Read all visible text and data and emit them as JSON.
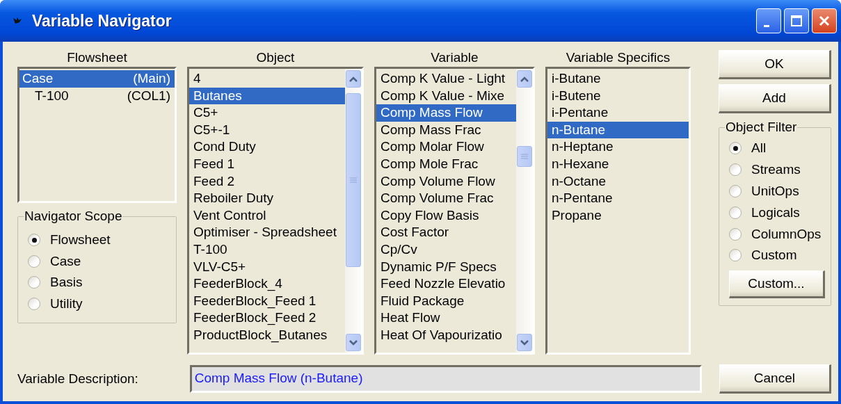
{
  "window": {
    "title": "Variable Navigator"
  },
  "flowsheet": {
    "header": "Flowsheet",
    "items": [
      {
        "name": "Case",
        "tag": "(Main)",
        "selected": true,
        "children": [
          {
            "name": "T-100",
            "tag": "(COL1)",
            "selected": false
          }
        ]
      }
    ]
  },
  "navigator_scope": {
    "title": "Navigator Scope",
    "options": [
      {
        "label": "Flowsheet",
        "selected": true
      },
      {
        "label": "Case",
        "selected": false
      },
      {
        "label": "Basis",
        "selected": false
      },
      {
        "label": "Utility",
        "selected": false
      }
    ]
  },
  "object": {
    "header": "Object",
    "items": [
      {
        "label": "4",
        "selected": false
      },
      {
        "label": "Butanes",
        "selected": true
      },
      {
        "label": "C5+",
        "selected": false
      },
      {
        "label": "C5+-1",
        "selected": false
      },
      {
        "label": "Cond Duty",
        "selected": false
      },
      {
        "label": "Feed 1",
        "selected": false
      },
      {
        "label": "Feed 2",
        "selected": false
      },
      {
        "label": "Reboiler Duty",
        "selected": false
      },
      {
        "label": "Vent Control",
        "selected": false
      },
      {
        "label": "Optimiser - Spreadsheet",
        "selected": false
      },
      {
        "label": "T-100",
        "selected": false
      },
      {
        "label": "VLV-C5+",
        "selected": false
      },
      {
        "label": "FeederBlock_4",
        "selected": false
      },
      {
        "label": "FeederBlock_Feed 1",
        "selected": false
      },
      {
        "label": "FeederBlock_Feed 2",
        "selected": false
      },
      {
        "label": "ProductBlock_Butanes",
        "selected": false
      }
    ]
  },
  "variable": {
    "header": "Variable",
    "items": [
      {
        "label": "Comp K Value - Light",
        "selected": false
      },
      {
        "label": "Comp K Value - Mixe",
        "selected": false
      },
      {
        "label": "Comp Mass Flow",
        "selected": true
      },
      {
        "label": "Comp Mass Frac",
        "selected": false
      },
      {
        "label": "Comp Molar Flow",
        "selected": false
      },
      {
        "label": "Comp Mole Frac",
        "selected": false
      },
      {
        "label": "Comp Volume Flow",
        "selected": false
      },
      {
        "label": "Comp Volume Frac",
        "selected": false
      },
      {
        "label": "Copy Flow Basis",
        "selected": false
      },
      {
        "label": "Cost Factor",
        "selected": false
      },
      {
        "label": "Cp/Cv",
        "selected": false
      },
      {
        "label": "Dynamic P/F Specs",
        "selected": false
      },
      {
        "label": "Feed Nozzle Elevatio",
        "selected": false
      },
      {
        "label": "Fluid Package",
        "selected": false
      },
      {
        "label": "Heat Flow",
        "selected": false
      },
      {
        "label": "Heat Of Vapourizatio",
        "selected": false
      }
    ]
  },
  "variable_specifics": {
    "header": "Variable Specifics",
    "items": [
      {
        "label": "i-Butane",
        "selected": false
      },
      {
        "label": "i-Butene",
        "selected": false
      },
      {
        "label": "i-Pentane",
        "selected": false
      },
      {
        "label": "n-Butane",
        "selected": true
      },
      {
        "label": "n-Heptane",
        "selected": false
      },
      {
        "label": "n-Hexane",
        "selected": false
      },
      {
        "label": "n-Octane",
        "selected": false
      },
      {
        "label": "n-Pentane",
        "selected": false
      },
      {
        "label": "Propane",
        "selected": false
      }
    ]
  },
  "buttons": [
    "OK",
    "Add"
  ],
  "object_filter": {
    "title": "Object Filter",
    "options": [
      {
        "label": "All",
        "selected": true
      },
      {
        "label": "Streams",
        "selected": false
      },
      {
        "label": "UnitOps",
        "selected": false
      },
      {
        "label": "Logicals",
        "selected": false
      },
      {
        "label": "ColumnOps",
        "selected": false
      },
      {
        "label": "Custom",
        "selected": false
      }
    ],
    "button": "Custom..."
  },
  "description": {
    "label": "Variable Description:",
    "value": "Comp Mass Flow (n-Butane)"
  },
  "cancel_button": "Cancel"
}
